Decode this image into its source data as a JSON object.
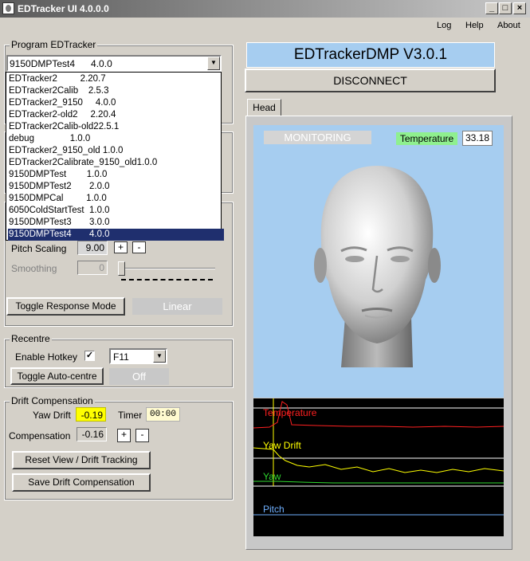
{
  "window": {
    "title": "EDTracker UI 4.0.0.0"
  },
  "menu": {
    "log": "Log",
    "help": "Help",
    "about": "About"
  },
  "program": {
    "group_label": "Program EDTracker",
    "selected": "9150DMPTest4      4.0.0",
    "items": [
      "EDTracker2         2.20.7",
      "EDTracker2Calib    2.5.3",
      "EDTracker2_9150     4.0.0",
      "EDTracker2-old2     2.20.4",
      "EDTracker2Calib-old22.5.1",
      "debug              1.0.0",
      "EDTracker2_9150_old 1.0.0",
      "EDTracker2Calibrate_9150_old1.0.0",
      "9150DMPTest        1.0.0",
      "9150DMPTest2       2.0.0",
      "9150DMPCal         1.0.0",
      "6050ColdStartTest  1.0.0",
      "9150DMPTest3       3.0.0",
      "9150DMPTest4       4.0.0"
    ],
    "selected_index": 13
  },
  "response": {
    "pitch_scaling_label": "Pitch Scaling",
    "pitch_scaling_value": "9.00",
    "smoothing_label": "Smoothing",
    "smoothing_value": "0",
    "toggle_label": "Toggle Response Mode",
    "mode_value": "Linear"
  },
  "recentre": {
    "group_label": "Recentre",
    "hotkey_label": "Enable Hotkey",
    "hotkey_value": "F11",
    "toggle_label": "Toggle Auto-centre",
    "auto_value": "Off"
  },
  "drift": {
    "group_label": "Drift Compensation",
    "yaw_drift_label": "Yaw Drift",
    "yaw_drift_value": "-0.19",
    "timer_label": "Timer",
    "timer_value": "00:00",
    "compensation_label": "Compensation",
    "compensation_value": "-0.16",
    "reset_label": "Reset View / Drift Tracking",
    "save_label": "Save Drift Compensation"
  },
  "device": {
    "name": "EDTrackerDMP V3.0.1",
    "disconnect_label": "DISCONNECT"
  },
  "tabs": {
    "head": "Head"
  },
  "monitor": {
    "status": "MONITORING",
    "temperature_label": "Temperature",
    "temperature_value": "33.18"
  },
  "graph": {
    "temperature_label": "Temperature",
    "yaw_drift_label": "Yaw Drift",
    "yaw_label": "Yaw",
    "pitch_label": "Pitch"
  },
  "colors": {
    "view_bg": "#a6cdf0",
    "graph_bg": "#000000",
    "temperature": "#ff2020",
    "yaw_drift": "#ffff00",
    "yaw": "#2fd82f",
    "pitch": "#6fb0ff",
    "drift_highlight": "#ffff00",
    "temp_badge": "#8ff08f"
  },
  "icons": {
    "app": "app-icon",
    "minimize": "minimize-icon",
    "maximize": "maximize-icon",
    "close": "close-icon"
  }
}
